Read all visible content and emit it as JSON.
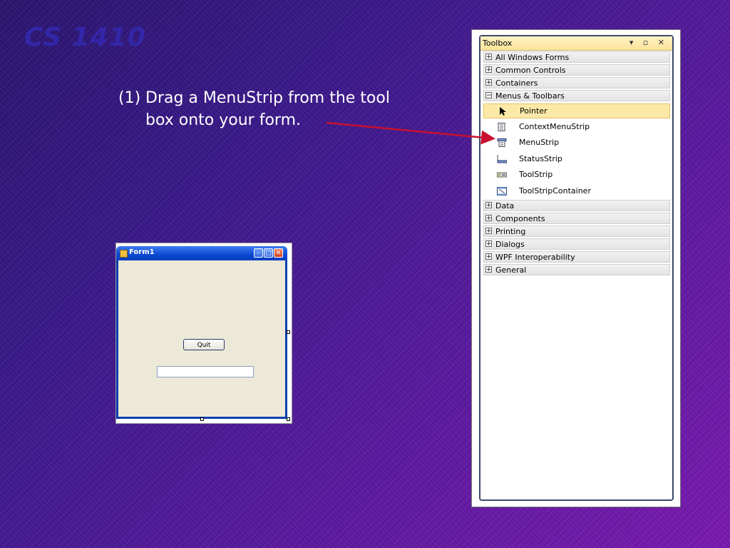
{
  "slide": {
    "course_title": "CS 1410",
    "instruction_number": "(1)",
    "instruction_line1": "Drag a MenuStrip from the tool",
    "instruction_line2": "box onto your form."
  },
  "form_window": {
    "title": "Form1",
    "quit_button_label": "Quit",
    "textbox_value": ""
  },
  "toolbox": {
    "title": "Toolbox",
    "header_icons": "▾ ▫ ✕",
    "categories_top": [
      {
        "sign": "+",
        "label": "All Windows Forms"
      },
      {
        "sign": "+",
        "label": "Common Controls"
      },
      {
        "sign": "+",
        "label": "Containers"
      },
      {
        "sign": "−",
        "label": "Menus & Toolbars"
      }
    ],
    "items": [
      {
        "label": "Pointer",
        "icon": "pointer-icon"
      },
      {
        "label": "ContextMenuStrip",
        "icon": "context-menu-strip-icon"
      },
      {
        "label": "MenuStrip",
        "icon": "menu-strip-icon"
      },
      {
        "label": "StatusStrip",
        "icon": "status-strip-icon"
      },
      {
        "label": "ToolStrip",
        "icon": "tool-strip-icon"
      },
      {
        "label": "ToolStripContainer",
        "icon": "tool-strip-container-icon"
      }
    ],
    "categories_bottom": [
      {
        "sign": "+",
        "label": "Data"
      },
      {
        "sign": "+",
        "label": "Components"
      },
      {
        "sign": "+",
        "label": "Printing"
      },
      {
        "sign": "+",
        "label": "Dialogs"
      },
      {
        "sign": "+",
        "label": "WPF Interoperability"
      },
      {
        "sign": "+",
        "label": "General"
      }
    ]
  },
  "colors": {
    "arrow": "#c8102e",
    "selection": "#fce9a8"
  }
}
